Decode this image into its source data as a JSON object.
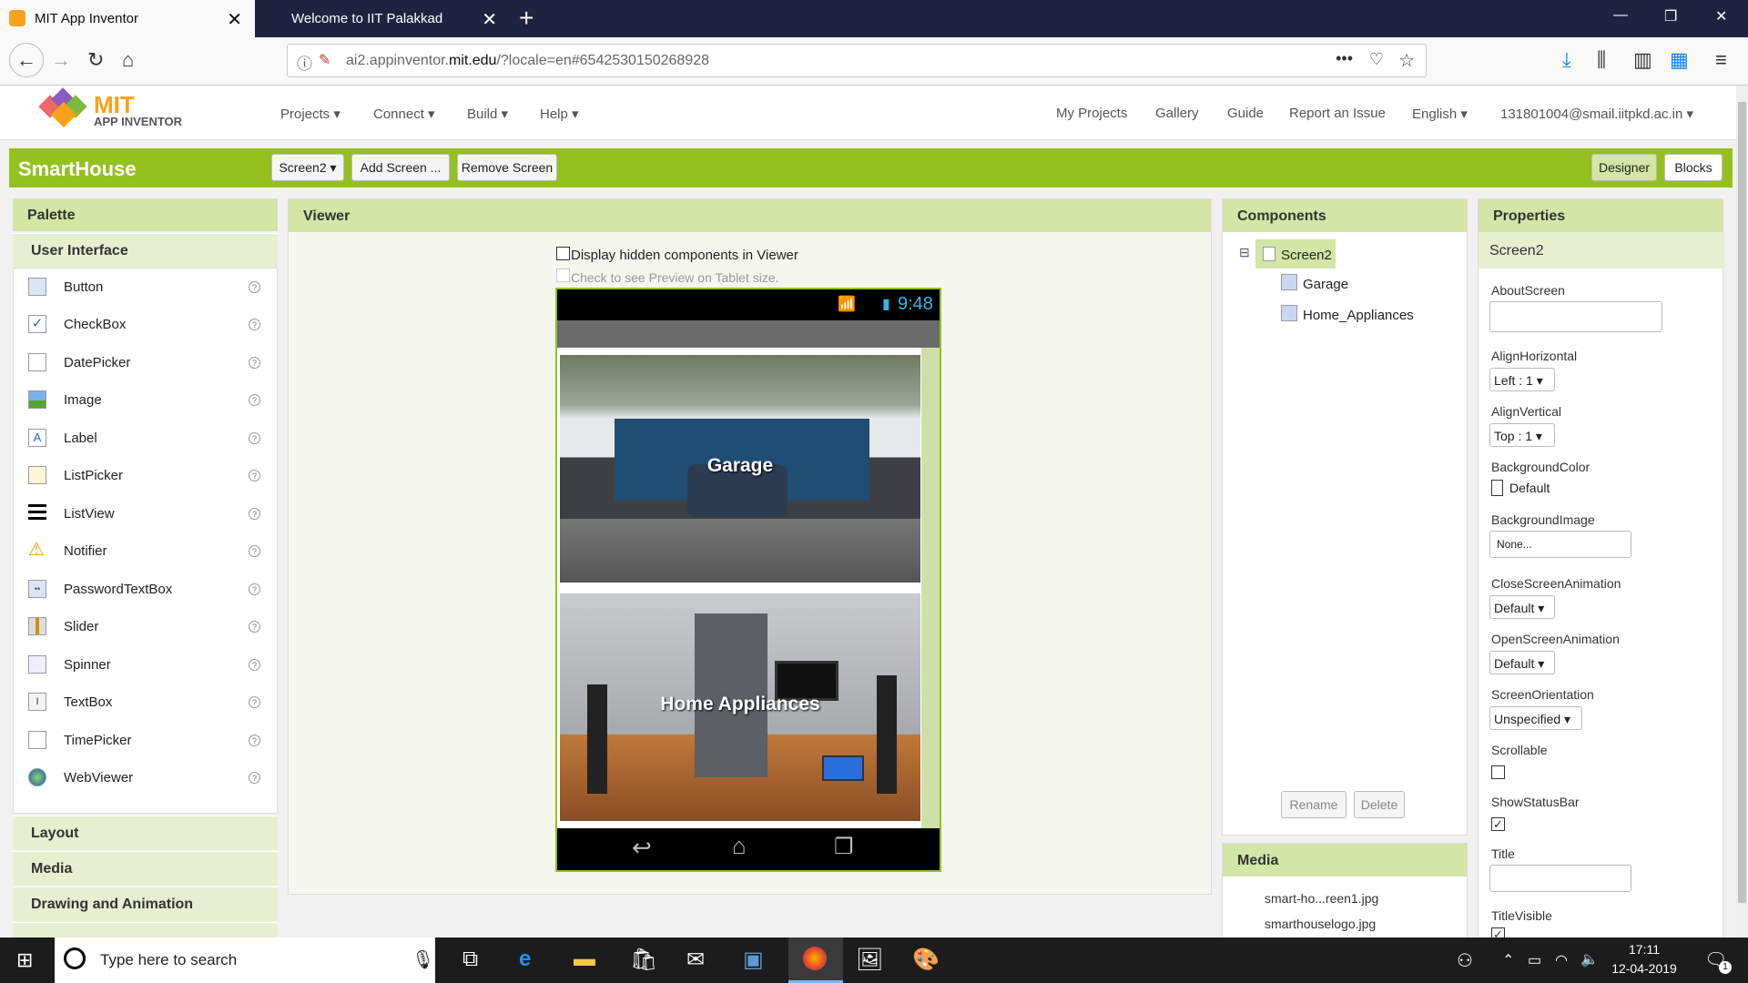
{
  "browser": {
    "tabs": [
      {
        "label": "MIT App Inventor",
        "active": true
      },
      {
        "label": "Welcome to IIT Palakkad",
        "active": false
      }
    ],
    "url_pre": "ai2.appinventor.",
    "url_domain": "mit.edu",
    "url_post": "/?locale=en#6542530150268928"
  },
  "header": {
    "logo_mit": "MIT",
    "logo_sub": "APP INVENTOR",
    "menus": [
      "Projects ▾",
      "Connect ▾",
      "Build ▾",
      "Help ▾"
    ],
    "links": [
      "My Projects",
      "Gallery",
      "Guide",
      "Report an Issue",
      "English ▾",
      "131801004@smail.iitpkd.ac.in ▾"
    ]
  },
  "toolbar": {
    "project": "SmartHouse",
    "screen_select": "Screen2 ▾",
    "add_screen": "Add Screen ...",
    "remove_screen": "Remove Screen",
    "designer": "Designer",
    "blocks": "Blocks"
  },
  "palette": {
    "title": "Palette",
    "section": "User Interface",
    "items": [
      "Button",
      "CheckBox",
      "DatePicker",
      "Image",
      "Label",
      "ListPicker",
      "ListView",
      "Notifier",
      "PasswordTextBox",
      "Slider",
      "Spinner",
      "TextBox",
      "TimePicker",
      "WebViewer"
    ],
    "help": "?",
    "categories": [
      "Layout",
      "Media",
      "Drawing and Animation"
    ]
  },
  "viewer": {
    "title": "Viewer",
    "hidden_label": "Display hidden components in Viewer",
    "tablet_label": "Check to see Preview on Tablet size.",
    "clock": "9:48",
    "garage_caption": "Garage",
    "appliances_caption": "Home Appliances"
  },
  "components": {
    "title": "Components",
    "toggle": "⊟",
    "screen": "Screen2",
    "children": [
      "Garage",
      "Home_Appliances"
    ],
    "rename": "Rename",
    "delete": "Delete"
  },
  "media": {
    "title": "Media",
    "files": [
      "smart-ho...reen1.jpg",
      "smarthouselogo.jpg"
    ]
  },
  "properties": {
    "title": "Properties",
    "screen": "Screen2",
    "about": "AboutScreen",
    "align_h": "AlignHorizontal",
    "align_h_val": "Left : 1 ▾",
    "align_v": "AlignVertical",
    "align_v_val": "Top : 1 ▾",
    "bg_color": "BackgroundColor",
    "bg_color_val": "Default",
    "bg_image": "BackgroundImage",
    "bg_image_val": "None...",
    "close_anim": "CloseScreenAnimation",
    "close_anim_val": "Default ▾",
    "open_anim": "OpenScreenAnimation",
    "open_anim_val": "Default ▾",
    "orientation": "ScreenOrientation",
    "orientation_val": "Unspecified ▾",
    "scrollable": "Scrollable",
    "show_status": "ShowStatusBar",
    "check": "✓",
    "title_prop": "Title",
    "title_visible": "TitleVisible"
  },
  "taskbar": {
    "search": "Type here to search",
    "time": "17:11",
    "date": "12-04-2019",
    "notif": "1"
  }
}
